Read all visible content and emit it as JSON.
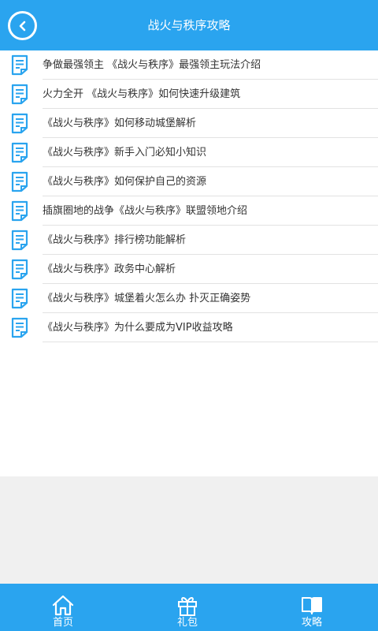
{
  "header": {
    "title": "战火与秩序攻略"
  },
  "articles": [
    {
      "title": "争做最强领主 《战火与秩序》最强领主玩法介绍"
    },
    {
      "title": "火力全开 《战火与秩序》如何快速升级建筑"
    },
    {
      "title": "《战火与秩序》如何移动城堡解析"
    },
    {
      "title": "《战火与秩序》新手入门必知小知识"
    },
    {
      "title": "《战火与秩序》如何保护自己的资源"
    },
    {
      "title": "插旗圈地的战争《战火与秩序》联盟领地介绍"
    },
    {
      "title": "《战火与秩序》排行榜功能解析"
    },
    {
      "title": "《战火与秩序》政务中心解析"
    },
    {
      "title": "《战火与秩序》城堡着火怎么办 扑灭正确姿势"
    },
    {
      "title": "《战火与秩序》为什么要成为VIP收益攻略"
    }
  ],
  "tabbar": {
    "home_label": "首页",
    "gift_label": "礼包",
    "guide_label": "攻略"
  },
  "colors": {
    "primary": "#2aa4ef",
    "icon": "#2aa4ef"
  }
}
